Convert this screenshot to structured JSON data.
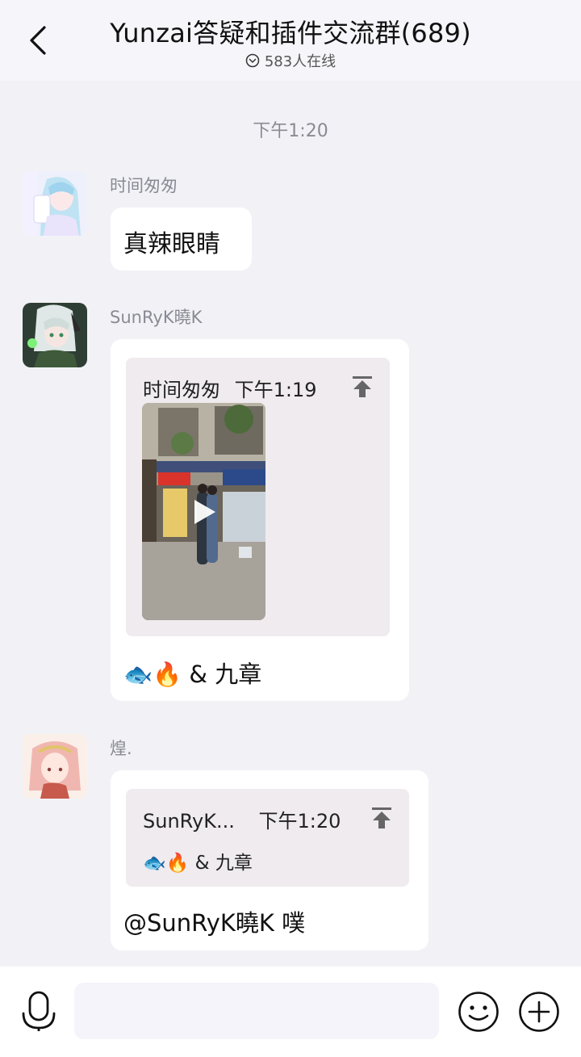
{
  "header": {
    "title": "Yunzai答疑和插件交流群(689)",
    "online": "583人在线"
  },
  "divider_time": "下午1:20",
  "messages": [
    {
      "sender": "时间匆匆",
      "text": "真辣眼睛"
    },
    {
      "sender": "SunRyK曉K",
      "quote": {
        "sender": "时间匆匆",
        "time": "下午1:19",
        "media": "video"
      },
      "text": "🐟🔥 & 九章"
    },
    {
      "sender": "煌.",
      "quote": {
        "sender": "SunRyK...",
        "time": "下午1:20",
        "text": "🐟🔥 & 九章"
      },
      "text": "@SunRyK曉K 噗"
    }
  ],
  "input": {
    "placeholder": ""
  },
  "colors": {
    "background": "#f2f2f6",
    "bubble": "#ffffff",
    "quote": "#efebee",
    "muted": "#8a8a95"
  },
  "icons": [
    "back-icon",
    "online-status-icon",
    "jump-to-original-icon",
    "play-icon",
    "voice-icon",
    "emoji-icon",
    "plus-icon"
  ]
}
